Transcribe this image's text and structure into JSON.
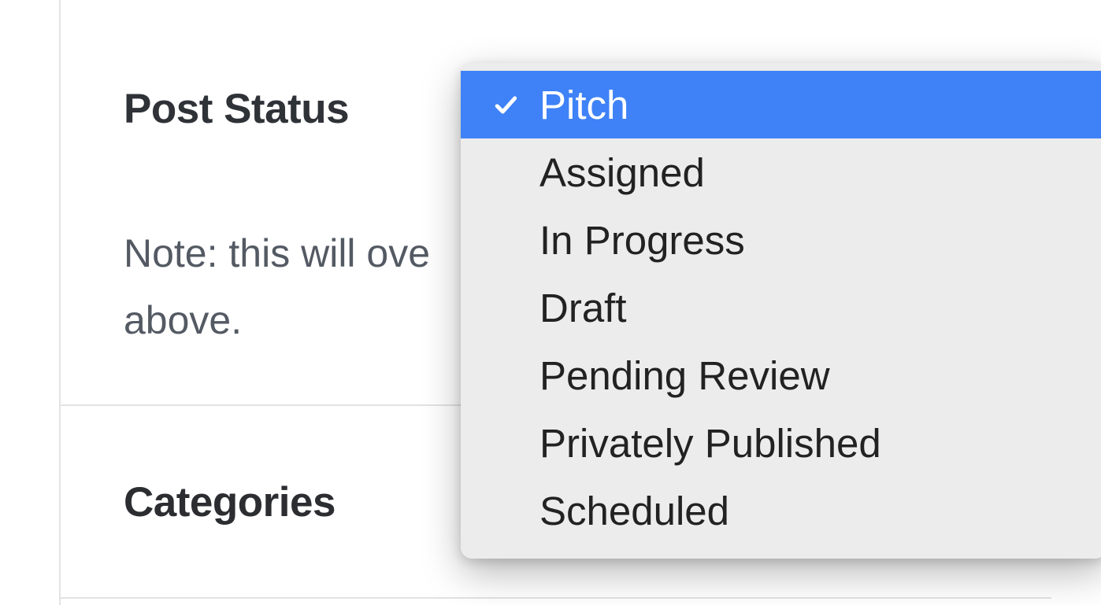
{
  "sections": {
    "post_status": {
      "label": "Post Status",
      "note_line1": "Note: this will ove",
      "note_line2": "above."
    },
    "categories": {
      "label": "Categories"
    }
  },
  "dropdown": {
    "selected_index": 0,
    "items": [
      {
        "label": "Pitch"
      },
      {
        "label": "Assigned"
      },
      {
        "label": "In Progress"
      },
      {
        "label": "Draft"
      },
      {
        "label": "Pending Review"
      },
      {
        "label": "Privately Published"
      },
      {
        "label": "Scheduled"
      }
    ]
  }
}
